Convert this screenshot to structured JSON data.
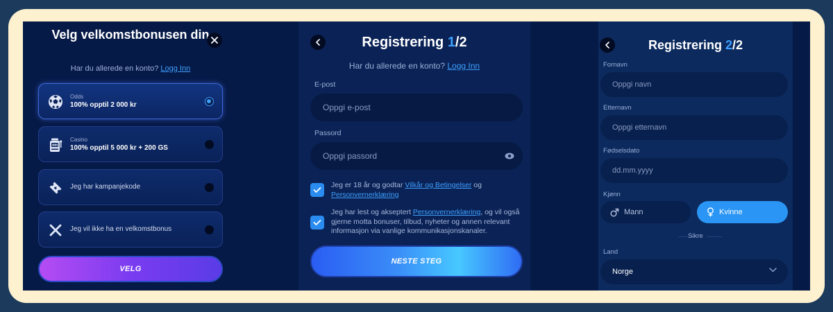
{
  "panel1": {
    "title": "Velg velkomstbonusen din",
    "login_prompt": "Har du allerede en konto?",
    "login_link": "Logg Inn",
    "options": [
      {
        "small": "Odds",
        "main": "100% opptil 2 000 kr",
        "selected": true,
        "icon": "soccer-ball-icon"
      },
      {
        "small": "Casino",
        "main": "100% opptil 5 000 kr + 200 GS",
        "selected": false,
        "icon": "slot-machine-icon"
      },
      {
        "label": "Jeg har kampanjekode",
        "selected": false,
        "icon": "ticket-icon"
      },
      {
        "label": "Jeg vil ikke ha en velkomstbonus",
        "selected": false,
        "icon": "x-icon"
      }
    ],
    "button": "VELG"
  },
  "panel2": {
    "title_prefix": "Registrering ",
    "title_step": "1",
    "title_suffix": "/2",
    "login_prompt": "Har du allerede en konto?",
    "login_link": "Logg Inn",
    "email_label": "E-post",
    "email_placeholder": "Oppgi e-post",
    "password_label": "Passord",
    "password_placeholder": "Oppgi passord",
    "terms_prefix": "Jeg er 18 år og godtar ",
    "terms_link1": "Vilkår og Betingelser",
    "terms_mid": " og ",
    "terms_link2": "Personvernerklæring",
    "privacy_prefix": "Jeg har lest og akseptert ",
    "privacy_link": "Personvernerklæring",
    "privacy_suffix": ", og vil også gjerne motta bonuser, tilbud, nyheter og annen relevant informasjon via vanlige kommunikasjonskanaler.",
    "button": "NESTE STEG"
  },
  "panel3": {
    "title_prefix": "Registrering ",
    "title_step": "2",
    "title_suffix": "/2",
    "first_name_label": "Fornavn",
    "first_name_placeholder": "Oppgi navn",
    "last_name_label": "Etternavn",
    "last_name_placeholder": "Oppgi etternavn",
    "dob_label": "Fødselsdato",
    "dob_placeholder": "dd.mm.yyyy",
    "gender_label": "Kjønn",
    "male": "Mann",
    "female": "Kvinne",
    "secure_label": "Sikre",
    "country_label": "Land",
    "country_value": "Norge"
  },
  "colors": {
    "accent": "#3fa0ff",
    "frame_border": "#1b3a5c",
    "frame_cream": "#fdf1cf",
    "background": "#061a47"
  }
}
